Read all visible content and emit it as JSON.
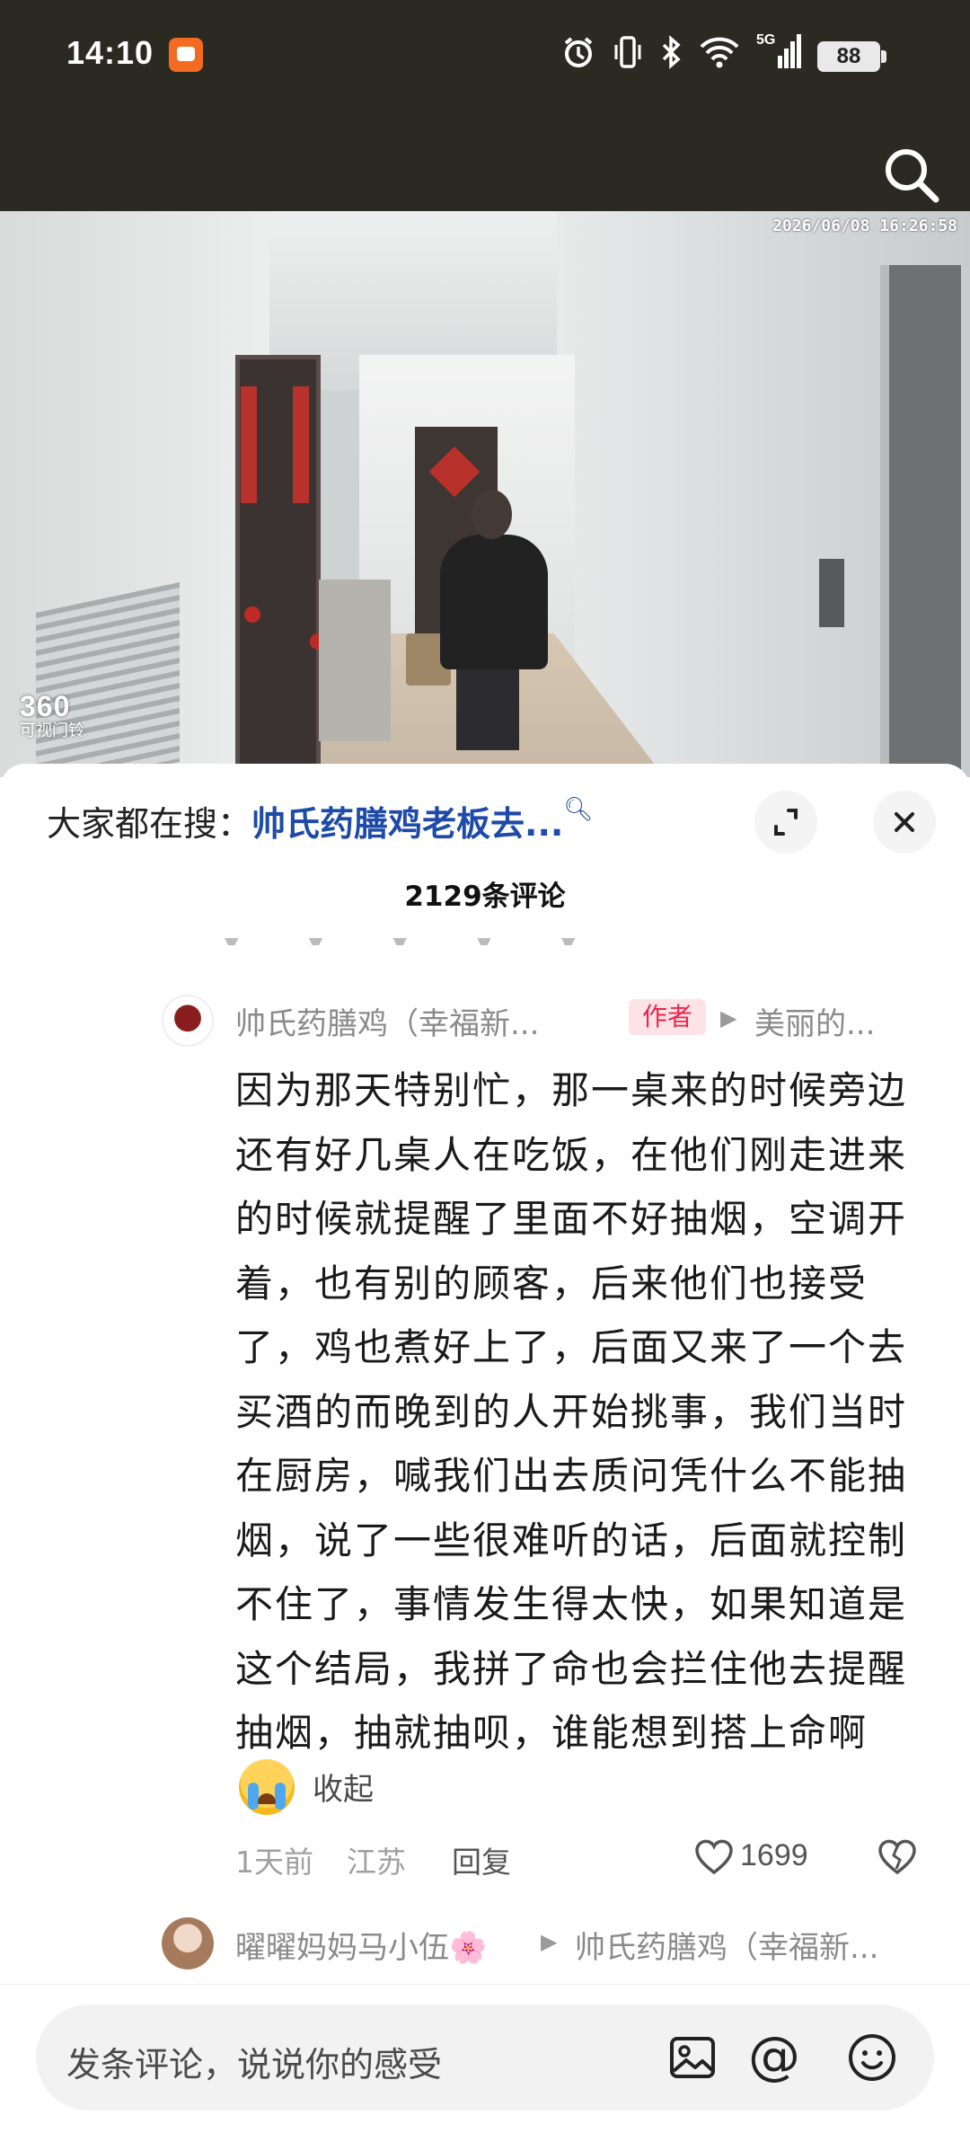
{
  "status_bar": {
    "time": "14:10",
    "network": "5G",
    "battery": "88",
    "icons": [
      "alarm-icon",
      "vibrate-icon",
      "bluetooth-icon",
      "wifi-icon",
      "signal-icon"
    ]
  },
  "video": {
    "timestamp": "2026/06/08 16:26:58",
    "logo_number": "360",
    "logo_text": "可视门铃"
  },
  "sheet": {
    "search_label": "大家都在搜：",
    "search_query": "帅氏药膳鸡老板去...",
    "comment_count": "2129条评论"
  },
  "comment": {
    "author": "帅氏药膳鸡（幸福新...",
    "author_tag": "作者",
    "reply_to": "美丽的...",
    "text_lines": [
      "因为那天特别忙，那一桌来的时候旁边",
      "还有好几桌人在吃饭，在他们刚走进来",
      "的时候就提醒了里面不好抽烟，空调开",
      "着，也有别的顾客，后来他们也接受",
      "了，鸡也煮好上了，后面又来了一个去",
      "买酒的而晚到的人开始挑事，我们当时",
      "在厨房，喊我们出去质问凭什么不能抽",
      "烟，说了一些很难听的话，后面就控制",
      "不住了，事情发生得太快，如果知道是",
      "这个结局，我拼了命也会拦住他去提醒",
      "抽烟，抽就抽呗，谁能想到搭上命啊"
    ],
    "collapse_label": "收起",
    "time_ago": "1天前",
    "location": "江苏",
    "reply_label": "回复",
    "like_count": "1699"
  },
  "comment2": {
    "author": "曜曜妈妈马小伍🌸",
    "reply_to": "帅氏药膳鸡（幸福新..."
  },
  "input": {
    "placeholder": "发条评论，说说你的感受"
  },
  "colors": {
    "top_background": "#2a2a22",
    "search_query": "#1e4aa8",
    "author_tag_text": "#e8264d",
    "author_tag_bg": "#fde3e6"
  }
}
